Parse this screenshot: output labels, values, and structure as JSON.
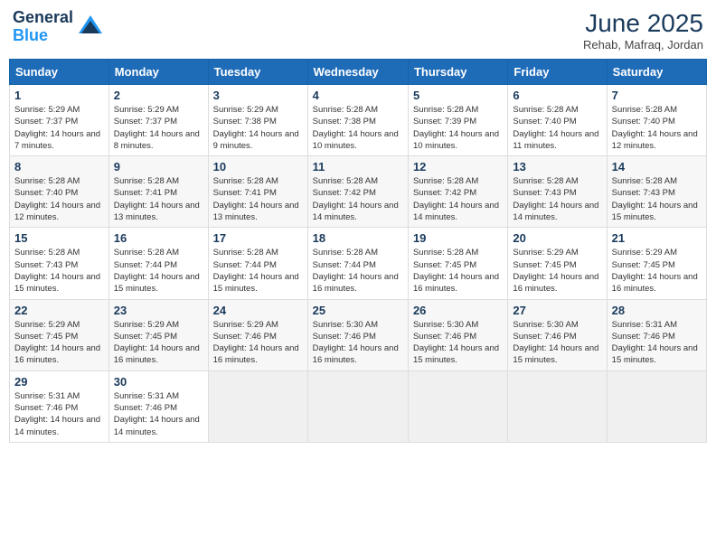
{
  "header": {
    "logo_line1": "General",
    "logo_line2": "Blue",
    "month_title": "June 2025",
    "subtitle": "Rehab, Mafraq, Jordan"
  },
  "days_of_week": [
    "Sunday",
    "Monday",
    "Tuesday",
    "Wednesday",
    "Thursday",
    "Friday",
    "Saturday"
  ],
  "weeks": [
    [
      {
        "day": "1",
        "sunrise": "5:29 AM",
        "sunset": "7:37 PM",
        "daylight": "14 hours and 7 minutes."
      },
      {
        "day": "2",
        "sunrise": "5:29 AM",
        "sunset": "7:37 PM",
        "daylight": "14 hours and 8 minutes."
      },
      {
        "day": "3",
        "sunrise": "5:29 AM",
        "sunset": "7:38 PM",
        "daylight": "14 hours and 9 minutes."
      },
      {
        "day": "4",
        "sunrise": "5:28 AM",
        "sunset": "7:38 PM",
        "daylight": "14 hours and 10 minutes."
      },
      {
        "day": "5",
        "sunrise": "5:28 AM",
        "sunset": "7:39 PM",
        "daylight": "14 hours and 10 minutes."
      },
      {
        "day": "6",
        "sunrise": "5:28 AM",
        "sunset": "7:40 PM",
        "daylight": "14 hours and 11 minutes."
      },
      {
        "day": "7",
        "sunrise": "5:28 AM",
        "sunset": "7:40 PM",
        "daylight": "14 hours and 12 minutes."
      }
    ],
    [
      {
        "day": "8",
        "sunrise": "5:28 AM",
        "sunset": "7:40 PM",
        "daylight": "14 hours and 12 minutes."
      },
      {
        "day": "9",
        "sunrise": "5:28 AM",
        "sunset": "7:41 PM",
        "daylight": "14 hours and 13 minutes."
      },
      {
        "day": "10",
        "sunrise": "5:28 AM",
        "sunset": "7:41 PM",
        "daylight": "14 hours and 13 minutes."
      },
      {
        "day": "11",
        "sunrise": "5:28 AM",
        "sunset": "7:42 PM",
        "daylight": "14 hours and 14 minutes."
      },
      {
        "day": "12",
        "sunrise": "5:28 AM",
        "sunset": "7:42 PM",
        "daylight": "14 hours and 14 minutes."
      },
      {
        "day": "13",
        "sunrise": "5:28 AM",
        "sunset": "7:43 PM",
        "daylight": "14 hours and 14 minutes."
      },
      {
        "day": "14",
        "sunrise": "5:28 AM",
        "sunset": "7:43 PM",
        "daylight": "14 hours and 15 minutes."
      }
    ],
    [
      {
        "day": "15",
        "sunrise": "5:28 AM",
        "sunset": "7:43 PM",
        "daylight": "14 hours and 15 minutes."
      },
      {
        "day": "16",
        "sunrise": "5:28 AM",
        "sunset": "7:44 PM",
        "daylight": "14 hours and 15 minutes."
      },
      {
        "day": "17",
        "sunrise": "5:28 AM",
        "sunset": "7:44 PM",
        "daylight": "14 hours and 15 minutes."
      },
      {
        "day": "18",
        "sunrise": "5:28 AM",
        "sunset": "7:44 PM",
        "daylight": "14 hours and 16 minutes."
      },
      {
        "day": "19",
        "sunrise": "5:28 AM",
        "sunset": "7:45 PM",
        "daylight": "14 hours and 16 minutes."
      },
      {
        "day": "20",
        "sunrise": "5:29 AM",
        "sunset": "7:45 PM",
        "daylight": "14 hours and 16 minutes."
      },
      {
        "day": "21",
        "sunrise": "5:29 AM",
        "sunset": "7:45 PM",
        "daylight": "14 hours and 16 minutes."
      }
    ],
    [
      {
        "day": "22",
        "sunrise": "5:29 AM",
        "sunset": "7:45 PM",
        "daylight": "14 hours and 16 minutes."
      },
      {
        "day": "23",
        "sunrise": "5:29 AM",
        "sunset": "7:45 PM",
        "daylight": "14 hours and 16 minutes."
      },
      {
        "day": "24",
        "sunrise": "5:29 AM",
        "sunset": "7:46 PM",
        "daylight": "14 hours and 16 minutes."
      },
      {
        "day": "25",
        "sunrise": "5:30 AM",
        "sunset": "7:46 PM",
        "daylight": "14 hours and 16 minutes."
      },
      {
        "day": "26",
        "sunrise": "5:30 AM",
        "sunset": "7:46 PM",
        "daylight": "14 hours and 15 minutes."
      },
      {
        "day": "27",
        "sunrise": "5:30 AM",
        "sunset": "7:46 PM",
        "daylight": "14 hours and 15 minutes."
      },
      {
        "day": "28",
        "sunrise": "5:31 AM",
        "sunset": "7:46 PM",
        "daylight": "14 hours and 15 minutes."
      }
    ],
    [
      {
        "day": "29",
        "sunrise": "5:31 AM",
        "sunset": "7:46 PM",
        "daylight": "14 hours and 14 minutes."
      },
      {
        "day": "30",
        "sunrise": "5:31 AM",
        "sunset": "7:46 PM",
        "daylight": "14 hours and 14 minutes."
      },
      null,
      null,
      null,
      null,
      null
    ]
  ]
}
